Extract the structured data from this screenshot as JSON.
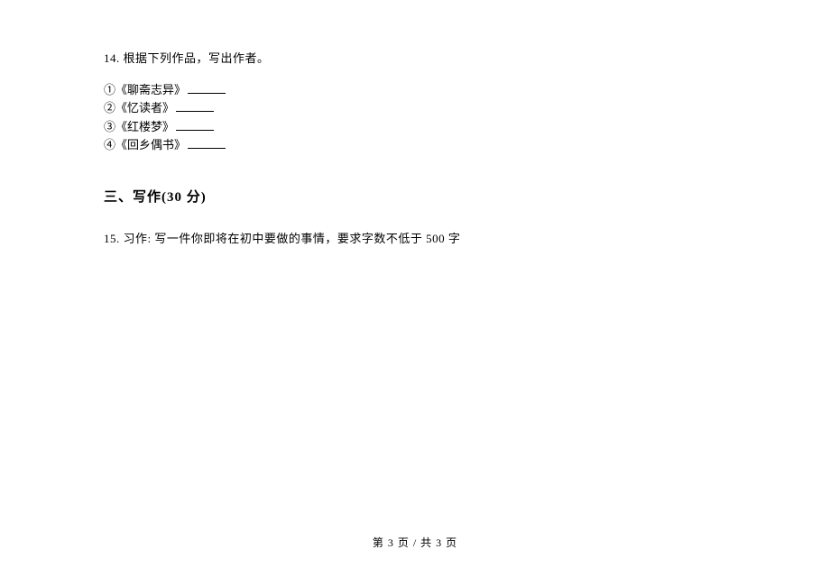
{
  "question14": {
    "number": "14.",
    "prompt": "根据下列作品，写出作者。",
    "items": [
      {
        "num": "①",
        "title": "《聊斋志异》"
      },
      {
        "num": "②",
        "title": "《忆读者》"
      },
      {
        "num": "③",
        "title": "《红楼梦》"
      },
      {
        "num": "④",
        "title": "《回乡偶书》"
      }
    ]
  },
  "section3": {
    "title": "三、写作(30 分)"
  },
  "question15": {
    "number": "15.",
    "prompt": "习作: 写一件你即将在初中要做的事情，要求字数不低于 500 字"
  },
  "footer": {
    "text": "第 3 页  /  共 3 页"
  }
}
